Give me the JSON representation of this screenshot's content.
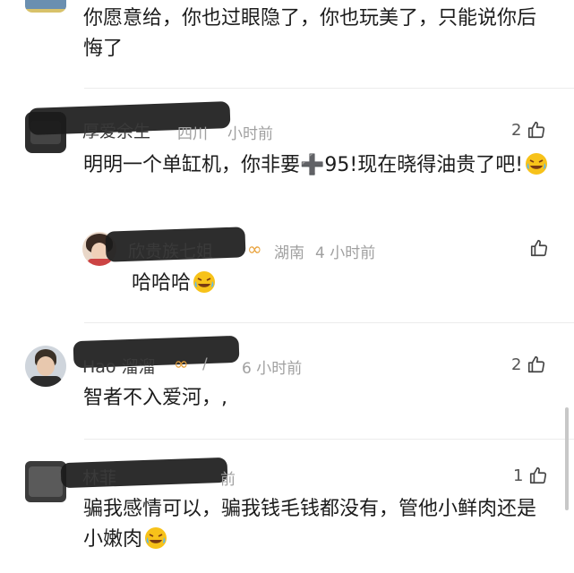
{
  "comments": [
    {
      "text": "你愿意给，你也过眼隐了，你也玩美了，只能说你后悔了"
    },
    {
      "name": "厚爱余生",
      "region": "四川",
      "time": "小时前",
      "likes": "2",
      "text": "明明一个单缸机，你非要➕95!现在晓得油贵了吧!",
      "reply": {
        "name": "欣贵族七姐",
        "badge": "∞",
        "region": "湖南",
        "time": "4 小时前",
        "text": "哈哈哈"
      }
    },
    {
      "name": "Hao 溜溜",
      "badge": "∞",
      "region": "/",
      "time": "6 小时前",
      "likes": "2",
      "text": "智者不入爱河，,"
    },
    {
      "name": "林菲",
      "time": "前",
      "likes": "1",
      "text": "骗我感情可以，骗我钱毛钱都没有，管他小鲜肉还是小嫩肉"
    }
  ],
  "emoji_name": "laugh-cry-emoji"
}
